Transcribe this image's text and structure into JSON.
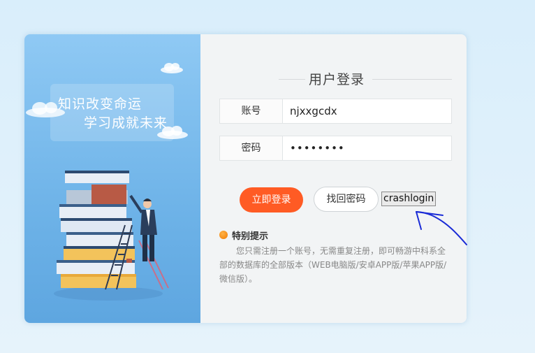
{
  "left_panel": {
    "slogan_line1": "知识改变命运",
    "slogan_line2": "学习成就未来"
  },
  "login": {
    "title": "用户登录",
    "account_label": "账号",
    "account_value": "njxxgcdx",
    "password_label": "密码",
    "password_value": "••••••••",
    "login_button": "立即登录",
    "find_password_button": "找回密码",
    "crash_button": "crashlogin"
  },
  "tips": {
    "title": "特别提示",
    "text": "您只需注册一个账号，无需重复注册，即可畅游中科系全部的数据库的全部版本（WEB电脑版/安卓APP版/苹果APP版/微信版）。"
  },
  "colors": {
    "primary": "#ff5b24",
    "panel_blue": "#6eb3e8",
    "annotation": "#1a2bd6"
  }
}
